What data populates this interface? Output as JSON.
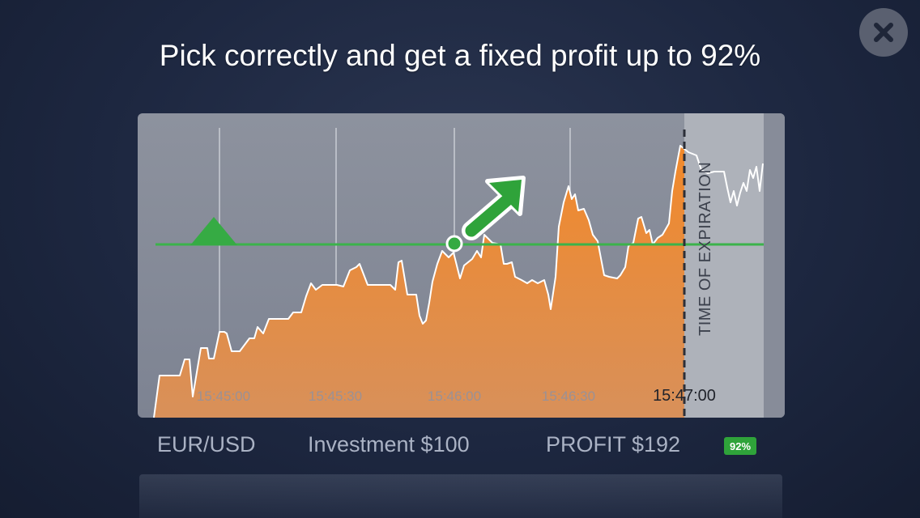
{
  "headline": "Pick correctly and get a fixed profit up to 92%",
  "close_icon": "close-icon",
  "chart": {
    "times": [
      "15:45:00",
      "15:45:30",
      "15:46:00",
      "15:46:30",
      "15:47:00"
    ],
    "expiration_label": "TIME OF EXPIRATION",
    "colors": {
      "area": "#f0892c",
      "strike_line": "#3bb34a",
      "up_arrow": "#2fa33a",
      "line": "#ffffff"
    }
  },
  "footer": {
    "pair": "EUR/USD",
    "investment": "Investment $100",
    "profit": "PROFIT $192",
    "profit_badge": "92%"
  }
}
